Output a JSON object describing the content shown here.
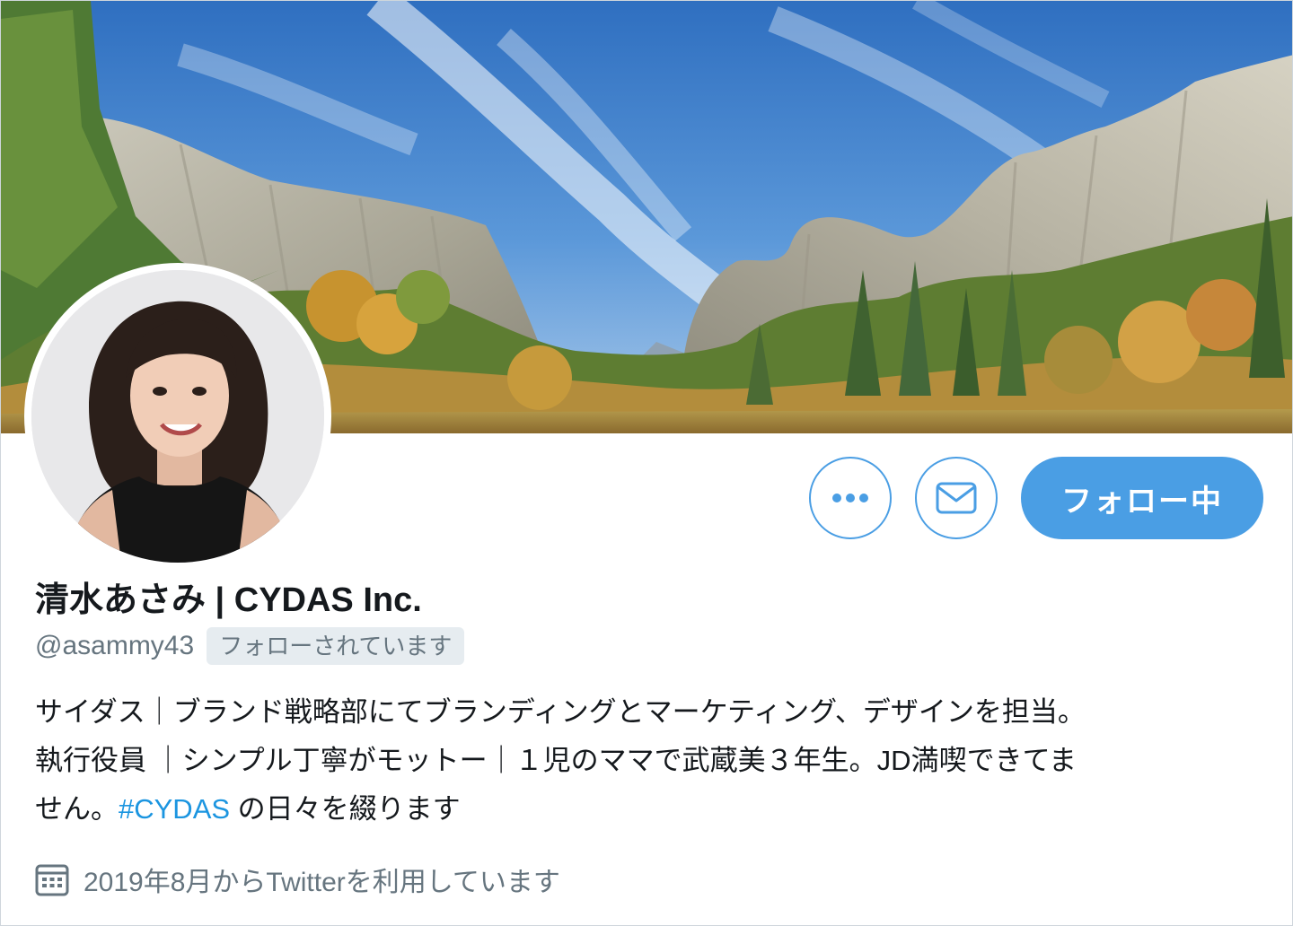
{
  "profile": {
    "display_name": "清水あさみ | CYDAS Inc.",
    "handle": "@asammy43",
    "follows_you_badge": "フォローされています",
    "bio": {
      "line1": "サイダス｜ブランド戦略部にてブランディングとマーケティング、デザインを担当。",
      "line2": "執行役員 ｜シンプル丁寧がモットー｜１児のママで武蔵美３年生。JD満喫できてま",
      "line3_before": "せん。",
      "hashtag": "#CYDAS",
      "line3_after": " の日々を綴ります"
    },
    "joined_text": "2019年8月からTwitterを利用しています"
  },
  "actions": {
    "follow_label": "フォロー中",
    "more_icon": "more-horizontal-icon",
    "message_icon": "envelope-icon"
  },
  "colors": {
    "accent": "#4a9ee4",
    "hashtag": "#1b95e0",
    "secondary_text": "#66757f",
    "badge_bg": "#e6ecf0"
  }
}
